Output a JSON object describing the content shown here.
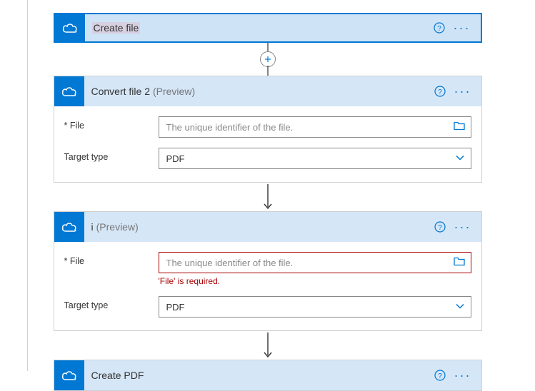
{
  "cards": {
    "create_file": {
      "title": "Create file"
    },
    "convert_file_2": {
      "title": "Convert file 2",
      "preview": "(Preview)",
      "file_label": "* File",
      "file_placeholder": "The unique identifier of the file.",
      "target_label": "Target type",
      "target_value": "PDF"
    },
    "step_i": {
      "title": "i",
      "preview": "(Preview)",
      "file_label": "* File",
      "file_placeholder": "The unique identifier of the file.",
      "file_error": "'File' is required.",
      "target_label": "Target type",
      "target_value": "PDF"
    },
    "create_pdf": {
      "title": "Create PDF"
    }
  }
}
